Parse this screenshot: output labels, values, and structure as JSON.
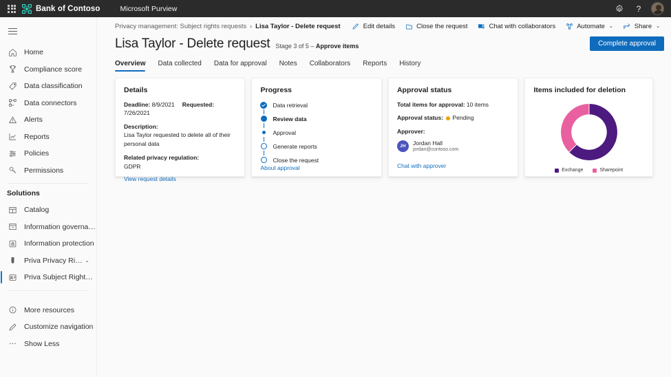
{
  "suitebar": {
    "waffle_label": "app-launcher",
    "brand": "Bank of Contoso",
    "app": "Microsoft Purview",
    "settings_icon": "gear-icon",
    "help_icon": "question-mark-icon",
    "avatar_label": "account-manager"
  },
  "sidebar": {
    "hamburger_label": "global-nav-toggle",
    "items": [
      {
        "label": "Home",
        "icon": "home-icon"
      },
      {
        "label": "Compliance score",
        "icon": "trophy-icon"
      },
      {
        "label": "Data classification",
        "icon": "tag-icon"
      },
      {
        "label": "Data connectors",
        "icon": "connectors-icon"
      },
      {
        "label": "Alerts",
        "icon": "alert-triangle-icon"
      },
      {
        "label": "Reports",
        "icon": "line-chart-icon"
      },
      {
        "label": "Policies",
        "icon": "sliders-icon"
      },
      {
        "label": "Permissions",
        "icon": "key-icon"
      }
    ],
    "solutions_header": "Solutions",
    "solutions": [
      {
        "label": "Catalog",
        "icon": "catalog-grid-icon",
        "chevron": ""
      },
      {
        "label": "Information governance",
        "icon": "archive-icon",
        "chevron": ""
      },
      {
        "label": "Information protection",
        "icon": "shield-lock-icon",
        "chevron": ""
      },
      {
        "label": "Priva Privacy Risk Managment",
        "icon": "privacy-icon",
        "chevron": "⌄"
      },
      {
        "label": "Priva Subject Rights Requests",
        "icon": "subject-rights-icon",
        "chevron": ""
      }
    ],
    "footer": [
      {
        "label": "More resources",
        "icon": "info-circle-icon"
      },
      {
        "label": "Customize navigation",
        "icon": "pencil-icon"
      },
      {
        "label": "Show Less",
        "icon": "ellipsis-icon"
      }
    ]
  },
  "breadcrumb": {
    "parent": "Privacy management: Subject rights requests",
    "separator": "›",
    "current": "Lisa Taylor - Delete request"
  },
  "commandbar": {
    "items": [
      {
        "label": "Edit details",
        "icon": "pencil-icon",
        "chevron": ""
      },
      {
        "label": "Close the request",
        "icon": "close-folder-icon",
        "chevron": ""
      },
      {
        "label": "Chat with collaborators",
        "icon": "teams-chat-icon",
        "chevron": ""
      },
      {
        "label": "Automate",
        "icon": "automate-flow-icon",
        "chevron": "⌄"
      },
      {
        "label": "Share",
        "icon": "share-icon",
        "chevron": "⌄"
      }
    ]
  },
  "page": {
    "title": "Lisa Taylor - Delete request",
    "stage_prefix": "Stage 3 of 5 – ",
    "stage_name": "Approve items",
    "primary_button": "Complete approval"
  },
  "tabs": [
    {
      "label": "Overview",
      "active": true
    },
    {
      "label": "Data collected",
      "active": false
    },
    {
      "label": "Data for approval",
      "active": false
    },
    {
      "label": "Notes",
      "active": false
    },
    {
      "label": "Collaborators",
      "active": false
    },
    {
      "label": "Reports",
      "active": false
    },
    {
      "label": "History",
      "active": false
    }
  ],
  "details_card": {
    "title": "Details",
    "deadline_label": "Deadline:",
    "deadline_value": "8/9/2021",
    "requested_label": "Requested:",
    "requested_value": "7/26/2021",
    "description_label": "Description:",
    "description_value": "Lisa Taylor requested to delete all of their personal data",
    "regulation_label": "Related privacy regulation:",
    "regulation_value": "GDPR",
    "link": "View request details"
  },
  "progress_card": {
    "title": "Progress",
    "steps": [
      {
        "label": "Data retrieval",
        "state": "done"
      },
      {
        "label": "Review data",
        "state": "current"
      },
      {
        "label": "Approval",
        "state": "active-small"
      },
      {
        "label": "Generate reports",
        "state": "pending"
      },
      {
        "label": "Close the request",
        "state": "pending"
      }
    ],
    "link": "About approval"
  },
  "approval_card": {
    "title": "Approval status",
    "total_label": "Total items for approval:",
    "total_value": "10 items",
    "status_label": "Approval status:",
    "status_value": "Pending",
    "status_color": "#f2a007",
    "approver_label": "Approver:",
    "approver_initials": "JH",
    "approver_name": "Jordan Hall",
    "approver_email": "jordan@contoso.com",
    "link": "Chat with approver"
  },
  "chart_data": {
    "type": "pie",
    "title": "Items included for deletion",
    "donut": true,
    "categories": [
      "Exchange",
      "Sharepoint"
    ],
    "values": [
      62.5,
      37.5
    ],
    "colors": [
      "#4d1a7f",
      "#e8609f"
    ],
    "legend_position": "bottom",
    "start_angle": 0,
    "xlabel": "",
    "ylabel": ""
  },
  "theme": {
    "accent": "#0f6cbd",
    "link": "#0f6cbd",
    "suitebar_bg": "#2b2b2b",
    "page_bg": "#fafafa"
  }
}
